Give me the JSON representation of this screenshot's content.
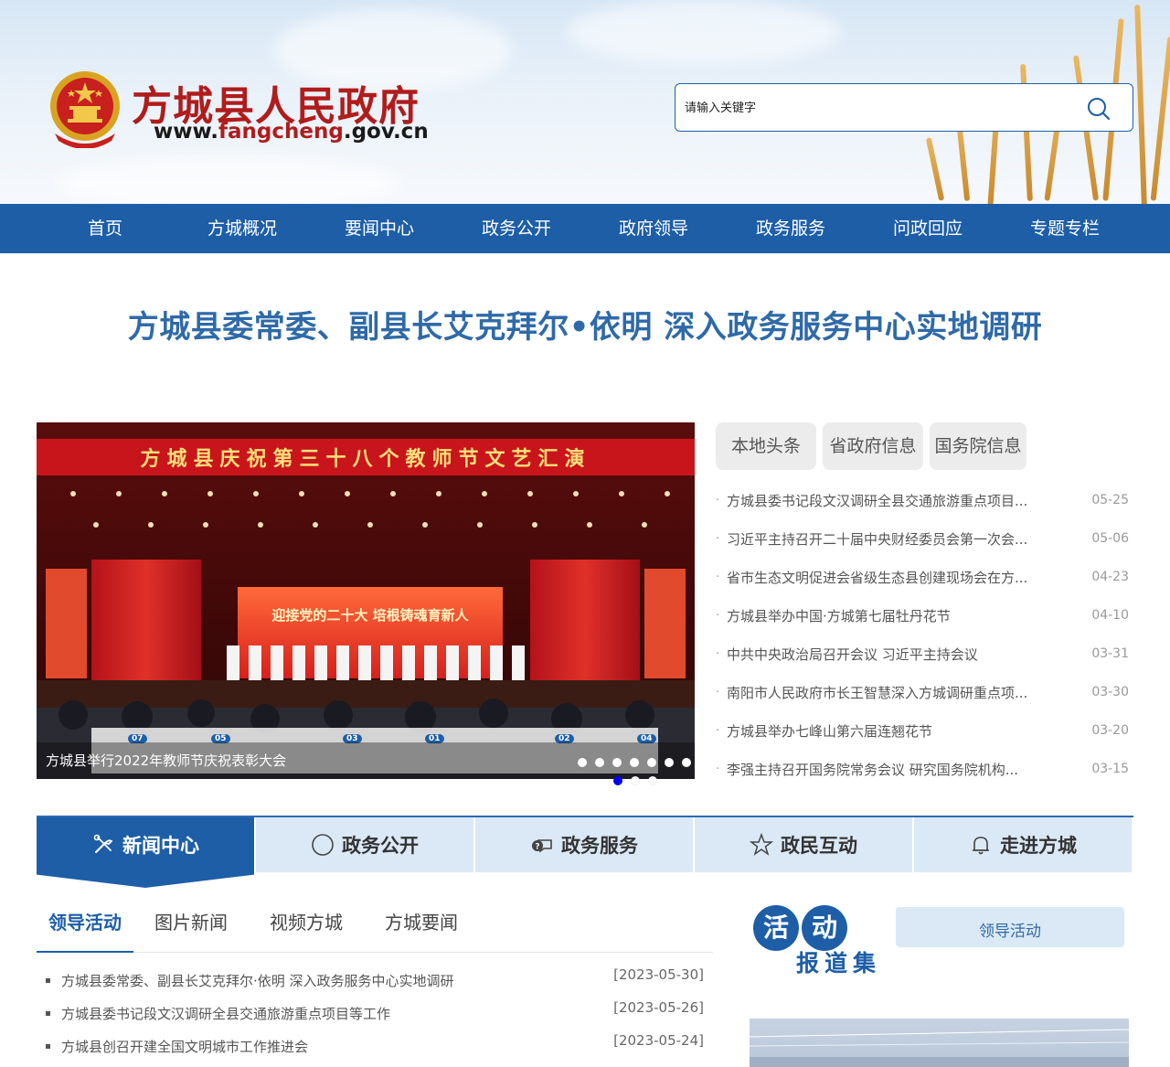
{
  "header": {
    "site_title": "方城县人民政府",
    "site_url_prefix": "www.",
    "site_url_domain": "fangcheng",
    "site_url_suffix": ".gov.cn",
    "search_placeholder": "请输入关键字"
  },
  "nav": {
    "items": [
      "首页",
      "方城概况",
      "要闻中心",
      "政务公开",
      "政府领导",
      "政务服务",
      "问政回应",
      "专题专栏"
    ]
  },
  "headline": "方城县委常委、副县长艾克拜尔•依明 深入政务服务中心实地调研",
  "slider": {
    "banner_text": "方城县庆祝第三十八个教师节文艺汇演",
    "stage_text": "迎接党的二十大 培根铸魂育新人",
    "caption": "方城县举行2022年教师节庆祝表彰大会",
    "seat_numbers": [
      "07",
      "05",
      "03",
      "01",
      "02",
      "04"
    ],
    "dot_count": 7,
    "active_dot": 1
  },
  "news": {
    "tabs": [
      "本地头条",
      "省政府信息",
      "国务院信息"
    ],
    "items": [
      {
        "title": "方城县委书记段文汉调研全县交通旅游重点项目...",
        "date": "05-25"
      },
      {
        "title": "习近平主持召开二十届中央财经委员会第一次会...",
        "date": "05-06"
      },
      {
        "title": "省市生态文明促进会省级生态县创建现场会在方...",
        "date": "04-23"
      },
      {
        "title": "方城县举办中国·方城第七届牡丹花节",
        "date": "04-10"
      },
      {
        "title": "中共中央政治局召开会议 习近平主持会议",
        "date": "03-31"
      },
      {
        "title": "南阳市人民政府市长王智慧深入方城调研重点项...",
        "date": "03-30"
      },
      {
        "title": "方城县举办七峰山第六届连翘花节",
        "date": "03-20"
      },
      {
        "title": "李强主持召开国务院常务会议 研究国务院机构...",
        "date": "03-15"
      }
    ]
  },
  "sections": {
    "tabs": [
      {
        "label": "新闻中心",
        "icon": "tools-icon"
      },
      {
        "label": "政务公开",
        "icon": "circle-icon"
      },
      {
        "label": "政务服务",
        "icon": "chat-icon"
      },
      {
        "label": "政民互动",
        "icon": "star-icon"
      },
      {
        "label": "走进方城",
        "icon": "bell-icon"
      }
    ]
  },
  "subtabs": {
    "items": [
      "领导活动",
      "图片新闻",
      "视频方城",
      "方城要闻"
    ],
    "list": [
      {
        "title": "方城县委常委、副县长艾克拜尔·依明 深入政务服务中心实地调研",
        "date": "[2023-05-30]"
      },
      {
        "title": "方城县委书记段文汉调研全县交通旅游重点项目等工作",
        "date": "[2023-05-26]"
      },
      {
        "title": "方城县创召开建全国文明城市工作推进会",
        "date": "[2023-05-24]"
      }
    ]
  },
  "activity": {
    "char1": "活",
    "char2": "动",
    "subtitle": "报道集",
    "button": "领导活动"
  },
  "colors": {
    "primary": "#1d5ea7",
    "title_red": "#b01c1c",
    "headline_blue": "#2f6aa8",
    "tab_light": "#dbe9f6"
  }
}
